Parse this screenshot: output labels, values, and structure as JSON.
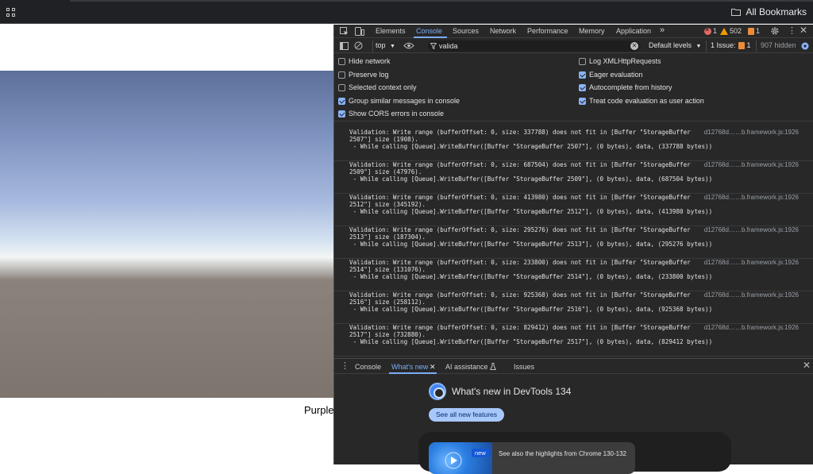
{
  "bookmarks": {
    "all_bookmarks_label": "All Bookmarks"
  },
  "page": {
    "label": "Purple"
  },
  "devtools": {
    "tabs": [
      "Elements",
      "Console",
      "Sources",
      "Network",
      "Performance",
      "Memory",
      "Application"
    ],
    "active_tab": "Console",
    "more_tabs_icon": "»",
    "counts": {
      "errors": "1",
      "warnings": "502",
      "issues": "1"
    },
    "console_toolbar": {
      "context": "top",
      "filter_value": "valida",
      "levels": "Default levels",
      "issues_label": "1 Issue:",
      "issues_count": "1",
      "hidden": "907 hidden"
    },
    "settings": {
      "left": [
        {
          "label": "Hide network",
          "checked": false
        },
        {
          "label": "Preserve log",
          "checked": false
        },
        {
          "label": "Selected context only",
          "checked": false
        },
        {
          "label": "Group similar messages in console",
          "checked": true
        },
        {
          "label": "Show CORS errors in console",
          "checked": true
        }
      ],
      "right": [
        {
          "label": "Log XMLHttpRequests",
          "checked": false
        },
        {
          "label": "Eager evaluation",
          "checked": true
        },
        {
          "label": "Autocomplete from history",
          "checked": true
        },
        {
          "label": "Treat code evaluation as user action",
          "checked": true
        }
      ]
    },
    "messages": [
      {
        "line1": "Validation: Write range (bufferOffset: 0, size: 337788) does not fit in [Buffer \"StorageBuffer",
        "line2": "2507\"] size (1908).",
        "line3": " - While calling [Queue].WriteBuffer([Buffer \"StorageBuffer 2507\"], (0 bytes), data, (337788 bytes))",
        "source": "d12768d……b.framework.js:1926"
      },
      {
        "line1": "Validation: Write range (bufferOffset: 0, size: 687504) does not fit in [Buffer \"StorageBuffer",
        "line2": "2509\"] size (47976).",
        "line3": " - While calling [Queue].WriteBuffer([Buffer \"StorageBuffer 2509\"], (0 bytes), data, (687504 bytes))",
        "source": "d12768d……b.framework.js:1926"
      },
      {
        "line1": "Validation: Write range (bufferOffset: 0, size: 413980) does not fit in [Buffer \"StorageBuffer",
        "line2": "2512\"] size (345192).",
        "line3": " - While calling [Queue].WriteBuffer([Buffer \"StorageBuffer 2512\"], (0 bytes), data, (413980 bytes))",
        "source": "d12768d……b.framework.js:1926"
      },
      {
        "line1": "Validation: Write range (bufferOffset: 0, size: 295276) does not fit in [Buffer \"StorageBuffer",
        "line2": "2513\"] size (187304).",
        "line3": " - While calling [Queue].WriteBuffer([Buffer \"StorageBuffer 2513\"], (0 bytes), data, (295276 bytes))",
        "source": "d12768d……b.framework.js:1926"
      },
      {
        "line1": "Validation: Write range (bufferOffset: 0, size: 233800) does not fit in [Buffer \"StorageBuffer",
        "line2": "2514\"] size (131076).",
        "line3": " - While calling [Queue].WriteBuffer([Buffer \"StorageBuffer 2514\"], (0 bytes), data, (233800 bytes))",
        "source": "d12768d……b.framework.js:1926"
      },
      {
        "line1": "Validation: Write range (bufferOffset: 0, size: 925368) does not fit in [Buffer \"StorageBuffer",
        "line2": "2516\"] size (258112).",
        "line3": " - While calling [Queue].WriteBuffer([Buffer \"StorageBuffer 2516\"], (0 bytes), data, (925368 bytes))",
        "source": "d12768d……b.framework.js:1926"
      },
      {
        "line1": "Validation: Write range (bufferOffset: 0, size: 829412) does not fit in [Buffer \"StorageBuffer",
        "line2": "2517\"] size (732880).",
        "line3": " - While calling [Queue].WriteBuffer([Buffer \"StorageBuffer 2517\"], (0 bytes), data, (829412 bytes))",
        "source": "d12768d……b.framework.js:1926"
      }
    ],
    "drawer": {
      "tabs": [
        "Console",
        "What's new",
        "AI assistance",
        "Issues"
      ],
      "active_tab": "What's new",
      "whats_new_title": "What's new in DevTools 134",
      "see_all_label": "See all new features",
      "new_pill": "new",
      "highlight_text": "See also the highlights from Chrome 130-132"
    }
  }
}
